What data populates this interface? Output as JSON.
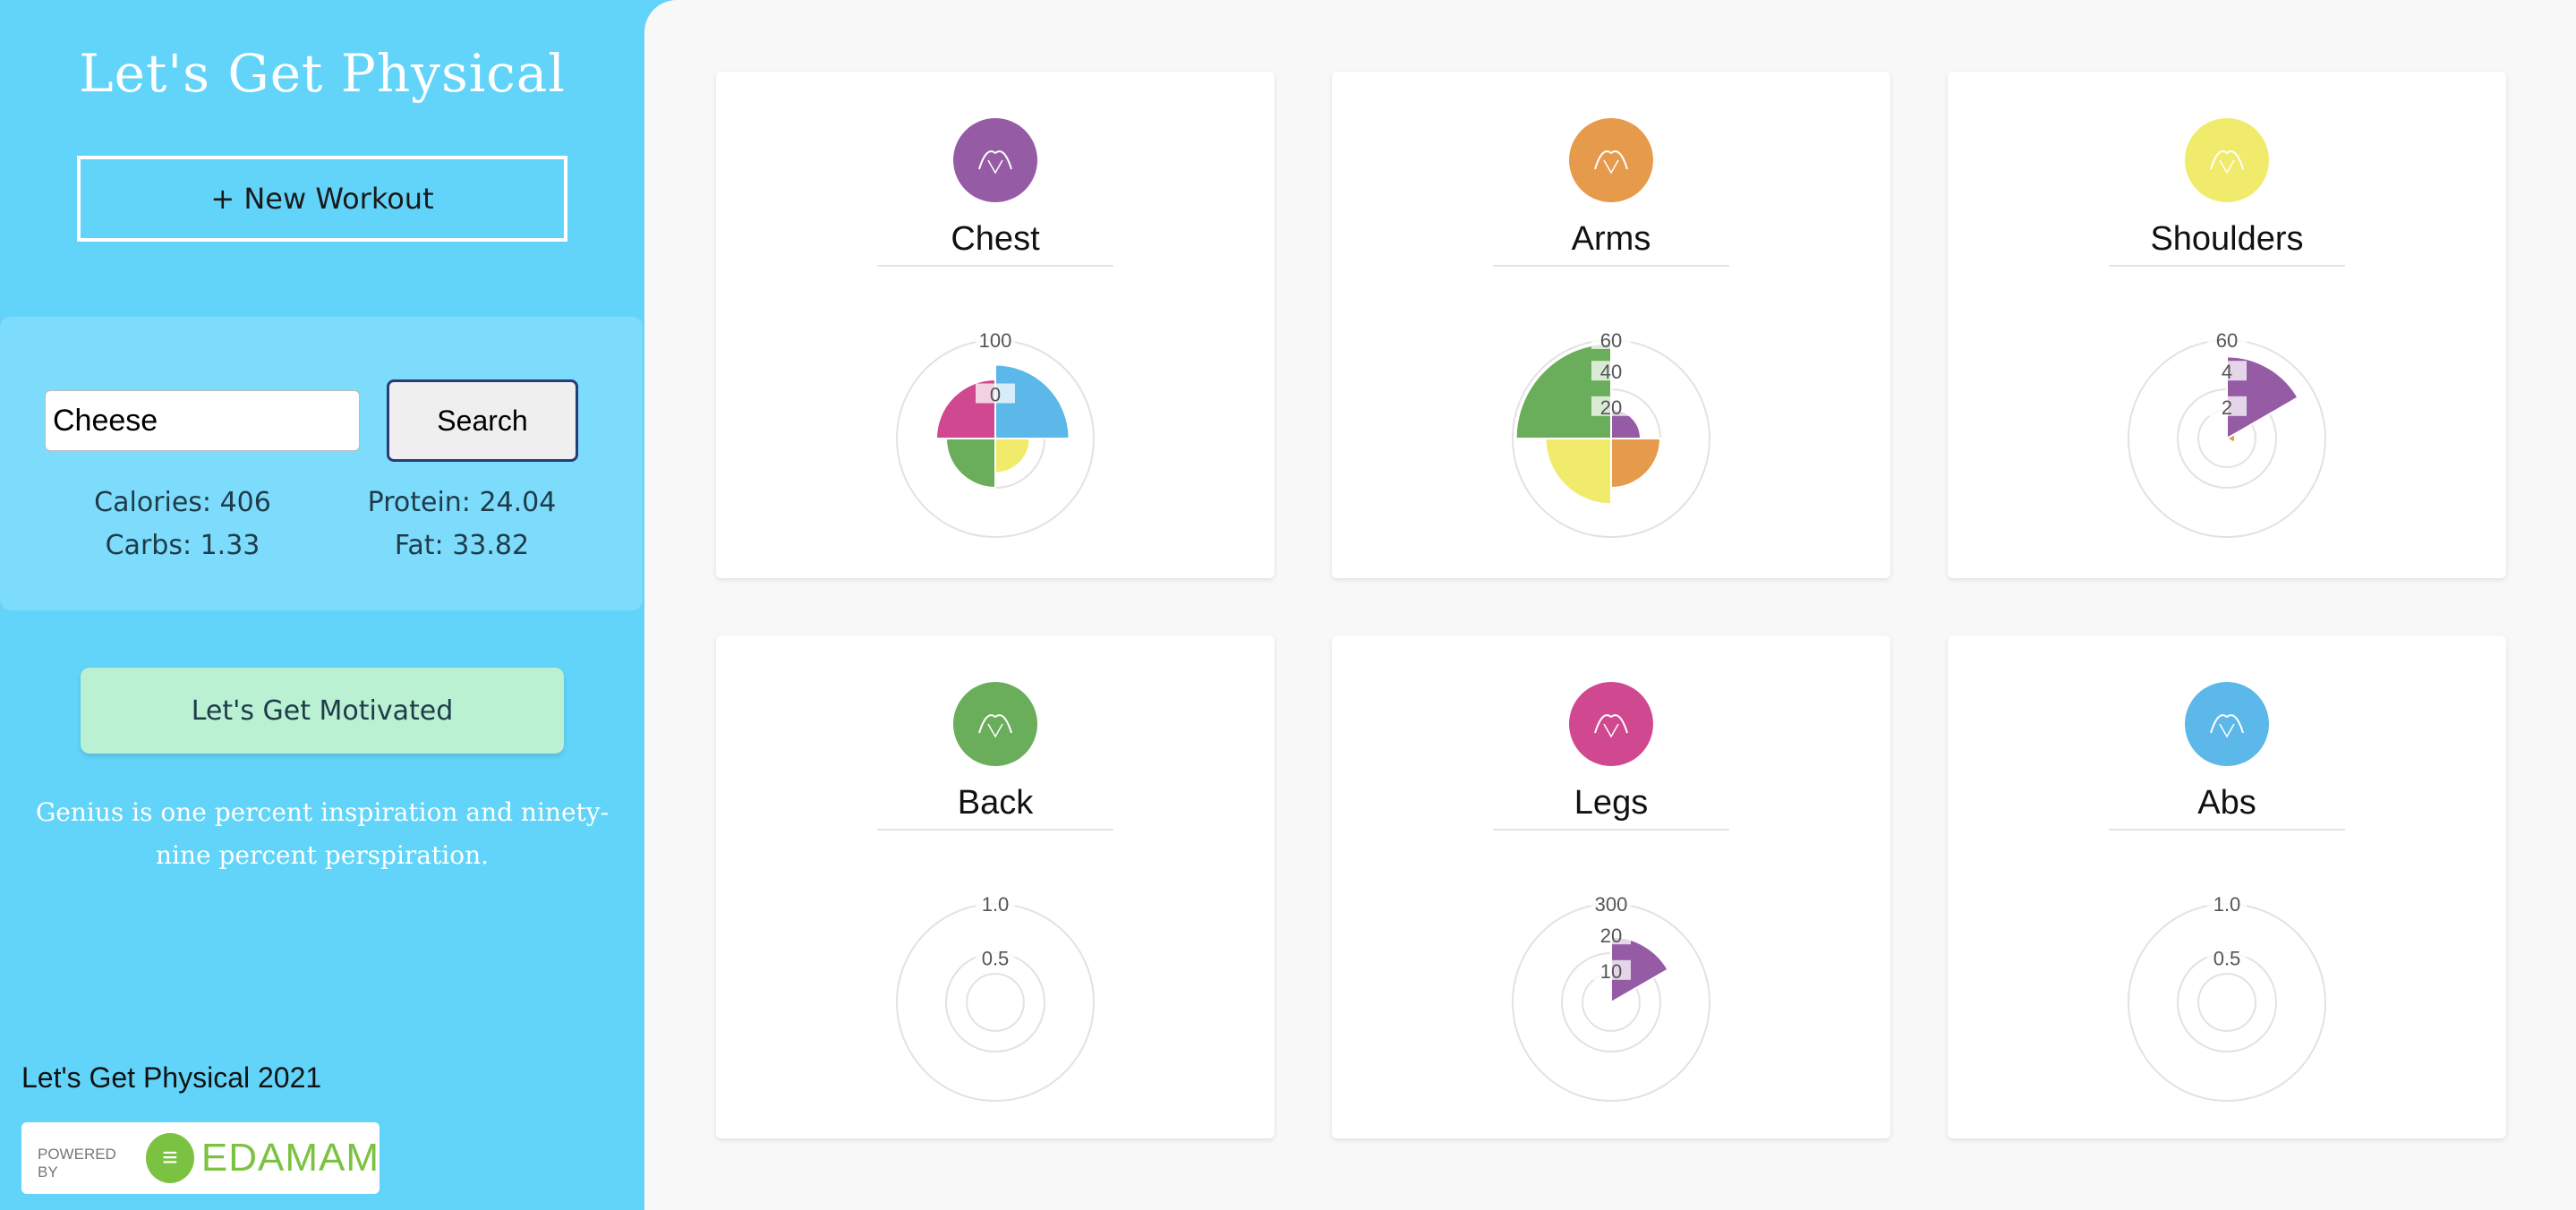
{
  "sidebar": {
    "title": "Let's Get Physical",
    "new_workout_label": "+ New Workout",
    "search": {
      "value": "Cheese",
      "button_label": "Search",
      "calories": "Calories: 406",
      "protein": "Protein: 24.04",
      "carbs": "Carbs: 1.33",
      "fat": "Fat: 33.82"
    },
    "motivate_label": "Let's Get Motivated",
    "quote": "Genius is one percent inspiration and ninety-nine percent perspiration.",
    "footer": "Let's Get Physical 2021",
    "powered_by": "POWERED BY",
    "edamam": "EDAMAM"
  },
  "colors": {
    "purple": "#955ba5",
    "orange": "#e69a4c",
    "yellow": "#f0eb6a",
    "green": "#6aad5a",
    "pink": "#d0488f",
    "blue": "#5cb8e8"
  },
  "cards": [
    {
      "title": "Chest",
      "icon": "chest-icon",
      "icon_color": "#955ba5",
      "chart_data": {
        "type": "polar",
        "ticks": [
          "100",
          "0"
        ],
        "rmax": 100,
        "segments": [
          {
            "color": "#5cb8e8",
            "value": 75
          },
          {
            "color": "#f0eb6a",
            "value": 35
          },
          {
            "color": "#6aad5a",
            "value": 50
          },
          {
            "color": "#d0488f",
            "value": 60
          }
        ]
      }
    },
    {
      "title": "Arms",
      "icon": "arm-icon",
      "icon_color": "#e69a4c",
      "chart_data": {
        "type": "polar",
        "ticks": [
          "60",
          "40",
          "20"
        ],
        "rmax": 60,
        "segments": [
          {
            "color": "#955ba5",
            "value": 18
          },
          {
            "color": "#e69a4c",
            "value": 30
          },
          {
            "color": "#f0eb6a",
            "value": 40
          },
          {
            "color": "#6aad5a",
            "value": 58
          }
        ]
      }
    },
    {
      "title": "Shoulders",
      "icon": "shoulder-icon",
      "icon_color": "#f0eb6a",
      "chart_data": {
        "type": "polar",
        "ticks": [
          "60",
          "4",
          "2"
        ],
        "rmax": 60,
        "segments": [
          {
            "color": "#955ba5",
            "value": 50
          },
          {
            "color": "#e69a4c",
            "value": 5
          }
        ]
      }
    },
    {
      "title": "Back",
      "icon": "back-icon",
      "icon_color": "#6aad5a",
      "chart_data": {
        "type": "polar",
        "ticks": [
          "1.0",
          "0.5"
        ],
        "rmax": 1,
        "segments": []
      }
    },
    {
      "title": "Legs",
      "icon": "leg-icon",
      "icon_color": "#d0488f",
      "chart_data": {
        "type": "polar",
        "ticks": [
          "300",
          "20",
          "10"
        ],
        "rmax": 300,
        "segments": [
          {
            "color": "#955ba5",
            "value": 200
          }
        ]
      }
    },
    {
      "title": "Abs",
      "icon": "abs-icon",
      "icon_color": "#5cb8e8",
      "chart_data": {
        "type": "polar",
        "ticks": [
          "1.0",
          "0.5"
        ],
        "rmax": 1,
        "segments": []
      }
    }
  ]
}
